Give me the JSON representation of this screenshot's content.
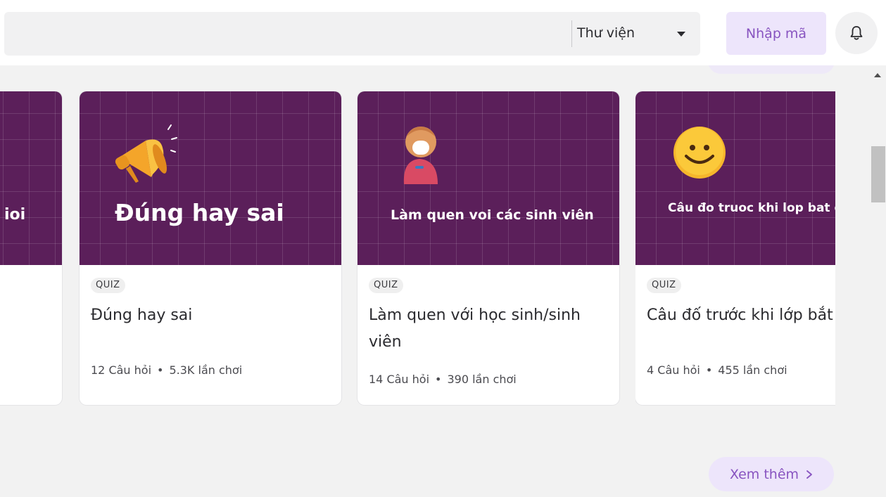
{
  "header": {
    "library_label": "Thư viện",
    "join_label": "Nhập mã"
  },
  "cards": [
    {
      "banner_title": "ioi",
      "tag": "",
      "title": "",
      "questions": "",
      "plays": ""
    },
    {
      "banner_title": "Đúng hay sai",
      "tag": "QUIZ",
      "title": "Đúng hay sai",
      "questions": "12 Câu hỏi",
      "plays": "5.3K lần chơi"
    },
    {
      "banner_title": "Làm quen voi các sinh viên",
      "tag": "QUIZ",
      "title": "Làm quen với học sinh/sinh viên",
      "questions": "14 Câu hỏi",
      "plays": "390 lần chơi"
    },
    {
      "banner_title": "Câu đo truoc khi lop bat dau",
      "tag": "QUIZ",
      "title": "Câu đố trước khi lớp bắt đầu",
      "questions": "4 Câu hỏi",
      "plays": "455 lần chơi"
    }
  ],
  "separator": "•",
  "more_label": "Xem thêm",
  "icons": {
    "bell": "bell-icon",
    "caret": "caret-down-icon",
    "chevron": "chevron-right-icon",
    "megaphone": "megaphone-icon",
    "student": "student-icon",
    "smiley": "smiley-icon"
  },
  "colors": {
    "accent": "#8854c0",
    "accent_bg": "#ede5fb",
    "banner": "#5b1f5a"
  }
}
